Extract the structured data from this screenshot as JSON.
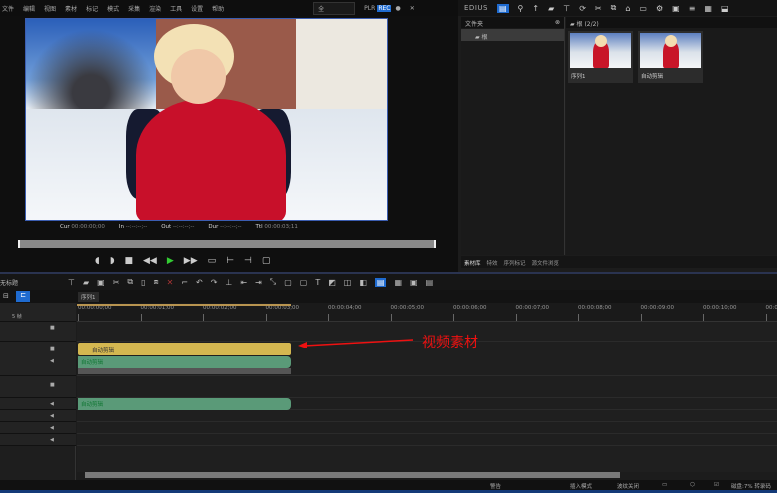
{
  "menu": [
    "文件",
    "编辑",
    "视图",
    "素材",
    "标记",
    "模式",
    "采集",
    "渲染",
    "工具",
    "设置",
    "帮助"
  ],
  "preview": {
    "selector": "全",
    "plr": "PLR",
    "rec": "REC",
    "timecodes": {
      "cur_label": "Cur",
      "cur": "00:00:00;00",
      "in_label": "In",
      "in": "--:--:--;--",
      "out_label": "Out",
      "out": "--:--:--;--",
      "dur_label": "Dur",
      "dur": "--:--:--;--",
      "ttl_label": "Ttl",
      "ttl": "00:00:03;11"
    }
  },
  "right_toolbar": {
    "logo": "EDIUS"
  },
  "folder_panel": {
    "title": "文件夹",
    "root": "根"
  },
  "bin": {
    "title": "根 (2/2)",
    "clips": [
      {
        "label": "序列1"
      },
      {
        "label": "自动剪辑"
      }
    ]
  },
  "bottom_tabs": [
    "素材库",
    "特效",
    "序列标记",
    "源文件浏览"
  ],
  "timeline": {
    "sequence_name": "无标题",
    "tab": "序列1",
    "track_scale": "5 帧",
    "ruler": [
      "00:00:00;00",
      "00:00:01;00",
      "00:00:02;00",
      "00:00:03;00",
      "00:00:04;00",
      "00:00:05;00",
      "00:00:06;00",
      "00:00:07;00",
      "00:00:08;00",
      "00:00:09:00",
      "00:00:10;00",
      "00:00"
    ],
    "clips": {
      "video": "自动剪辑",
      "va_audio": "自动剪辑",
      "audio": "自动剪辑"
    },
    "annotation": "视频素材"
  },
  "status": {
    "warning": "警告",
    "mode": "插入模式",
    "ripple": "波纹关闭",
    "disk": "磁盘:7% 转录码"
  },
  "colors": {
    "accent": "#1f6bd0",
    "video_clip": "#d4b750",
    "audio_clip": "#5a9a78",
    "annotation": "#e11111"
  }
}
